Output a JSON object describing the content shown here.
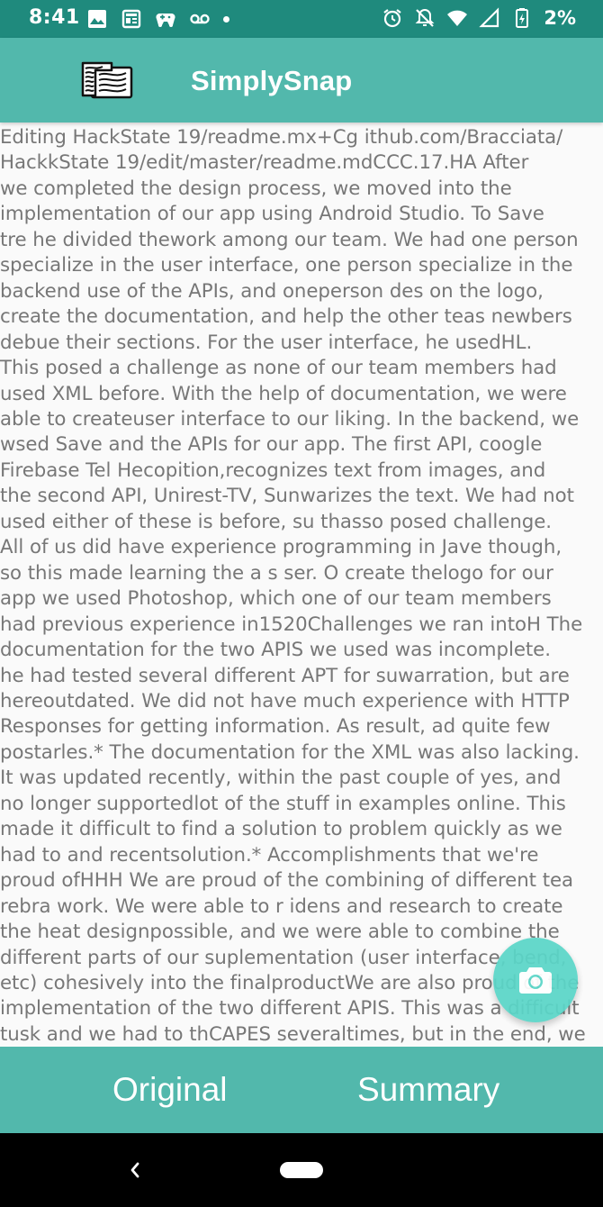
{
  "status_bar": {
    "time": "8:41",
    "battery": "2%",
    "left_icons": [
      "image-icon",
      "news-icon",
      "game-controller-icon",
      "voicemail-icon",
      "dot-icon"
    ],
    "right_icons": [
      "alarm-icon",
      "notifications-off-icon",
      "wifi-icon",
      "signal-icon",
      "battery-charging-icon"
    ]
  },
  "app_bar": {
    "title": "SimplySnap",
    "logo_icon": "scanned-document-logo-icon",
    "background": "#52b8ac"
  },
  "content": {
    "text": "Editing HackState 19/readme.mx+Cg ithub.com/Bracciata/\nHackkState 19/edit/master/readme.mdCCC.17.HA After\nwe completed the design process, we moved into the\nimplementation of our app using Android Studio. To Save\ntre he divided thework among our team. We had one person\nspecialize in the user interface, one person specialize in the\nbackend use of the APIs, and oneperson des on the logo,\ncreate the documentation, and help the other teas newbers\ndebue their sections. For the user interface, he usedHL.\nThis posed a challenge as none of our team members had\nused XML before. With the help of documentation, we were\nable to createuser interface to our liking. In the backend, we\nwsed Save and the APIs for our app. The first API, coogle\nFirebase Tel Hecopition,recognizes text from images, and\nthe second API, Unirest-TV, Sunwarizes the text. We had not\nused either of these is before, su thasso posed challenge.\nAll of us did have experience programming in Jave though,\nso this made learning the a s ser. O create thelogo for our\napp we used Photoshop, which one of our team members\nhad previous experience in1520Challenges we ran intoH The\ndocumentation for the two APIS we used was incomplete.\nhe had tested several different APT for suwarration, but are\nhereoutdated. We did not have much experience with HTTP\nResponses for getting information. As result, ad quite few\npostarles.* The documentation for the XML was also lacking.\nIt was updated recently, within the past couple of yes, and\nno longer supportedlot of the stuff in examples online. This\nmade it difficult to find a solution to problem quickly as we\nhad to and recentsolution.* Accomplishments that we're\nproud ofHHH We are proud of the combining of different tea\nrebra work. We were able to r idens and research to create\nthe heat designpossible, and we were able to combine the\ndifferent parts of our suplementation (user interface, bend,\netc) cohesively into the finalproductWe are also proud of the\nimplementation of the two different APIS. This was a difficult\ntusk and we had to thCAPES severaltimes, but in the end, we"
  },
  "fab": {
    "icon": "camera-icon",
    "color": "#5ad6c8"
  },
  "bottom_bar": {
    "tabs": [
      {
        "label": "Original"
      },
      {
        "label": "Summary"
      }
    ]
  },
  "nav_bar": {
    "back_icon": "back-chevron-icon",
    "home_icon": "home-pill-icon"
  }
}
